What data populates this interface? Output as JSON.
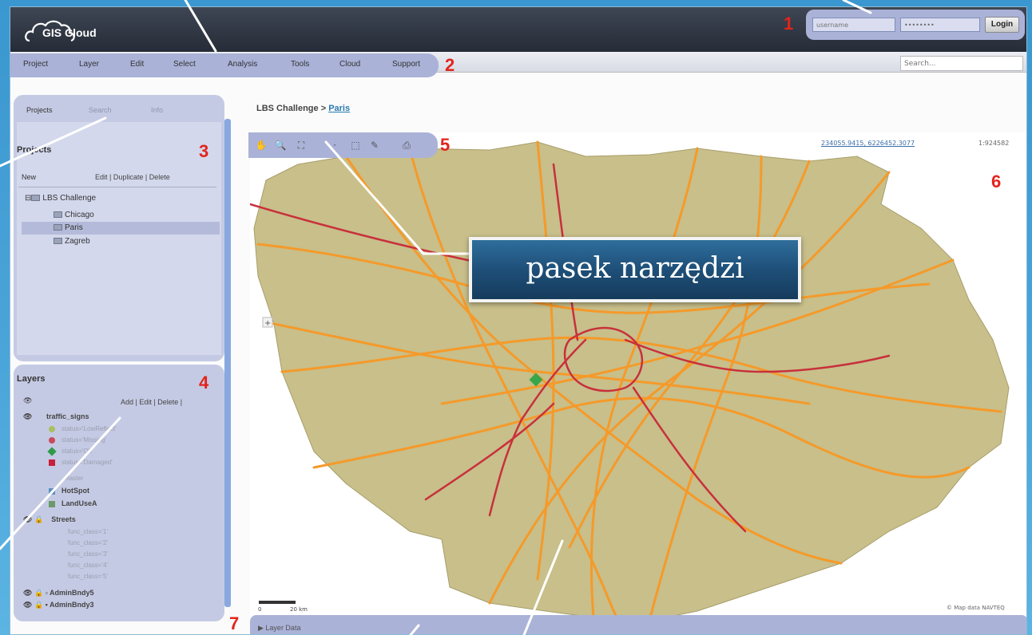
{
  "header": {
    "logo_text": "GIS Cloud",
    "username_placeholder": "username",
    "password_value": "••••••••",
    "login_label": "Login"
  },
  "menu": {
    "items": [
      "Project",
      "Layer",
      "Edit",
      "Select",
      "Analysis",
      "Tools",
      "Cloud",
      "Support"
    ],
    "search_placeholder": "Search..."
  },
  "breadcrumb": {
    "parent": "LBS Challenge",
    "separator": ">",
    "current": "Paris"
  },
  "left_panel": {
    "tabs": [
      "Projects",
      "Search",
      "Info"
    ],
    "projects_title": "Projects",
    "actions": {
      "new": "New",
      "edit": "Edit",
      "duplicate": "Duplicate",
      "delete": "Delete"
    },
    "tree": {
      "root": "LBS Challenge",
      "children": [
        "Chicago",
        "Paris",
        "Zagreb"
      ],
      "selected": "Paris"
    }
  },
  "layers_panel": {
    "title": "Layers",
    "actions": {
      "add": "Add",
      "edit": "Edit",
      "delete": "Delete"
    },
    "layers": [
      {
        "name": "traffic_signs",
        "subs": [
          {
            "label": "status='LowReflect'",
            "color": "#a8c060"
          },
          {
            "label": "status='Missing'",
            "color": "#c84a5a"
          },
          {
            "label": "status='Ok'",
            "color": "#2e9a4a"
          },
          {
            "label": "status='Damaged'",
            "color": "#c8203a"
          }
        ]
      },
      {
        "name": "Raster",
        "subs": []
      },
      {
        "name": "HotSpot",
        "subs": []
      },
      {
        "name": "LandUseA",
        "subs": []
      },
      {
        "name": "Streets",
        "subs": [
          {
            "label": "func_class='1'"
          },
          {
            "label": "func_class='2'"
          },
          {
            "label": "func_class='3'"
          },
          {
            "label": "func_class='4'"
          },
          {
            "label": "func_class='5'"
          }
        ]
      },
      {
        "name": "AdminBndy5",
        "subs": []
      },
      {
        "name": "AdminBndy3",
        "subs": []
      }
    ]
  },
  "map": {
    "coords": "234055.9415, 6226452.3077",
    "scale": "1:924582",
    "scalebar_start": "0",
    "scalebar_end": "20 km",
    "attribution": "© Map data NAVTEQ",
    "bottom_label": "Layer Data"
  },
  "annotations": {
    "callout": "pasek narzędzi",
    "numbers": [
      "1",
      "2",
      "3",
      "4",
      "5",
      "6",
      "7"
    ]
  },
  "colors": {
    "accent_number": "#e3241b",
    "highlight": "#aab2d8",
    "land": "#c8bf8a",
    "major_road": "#f59a2a",
    "motorway": "#c8303c"
  }
}
